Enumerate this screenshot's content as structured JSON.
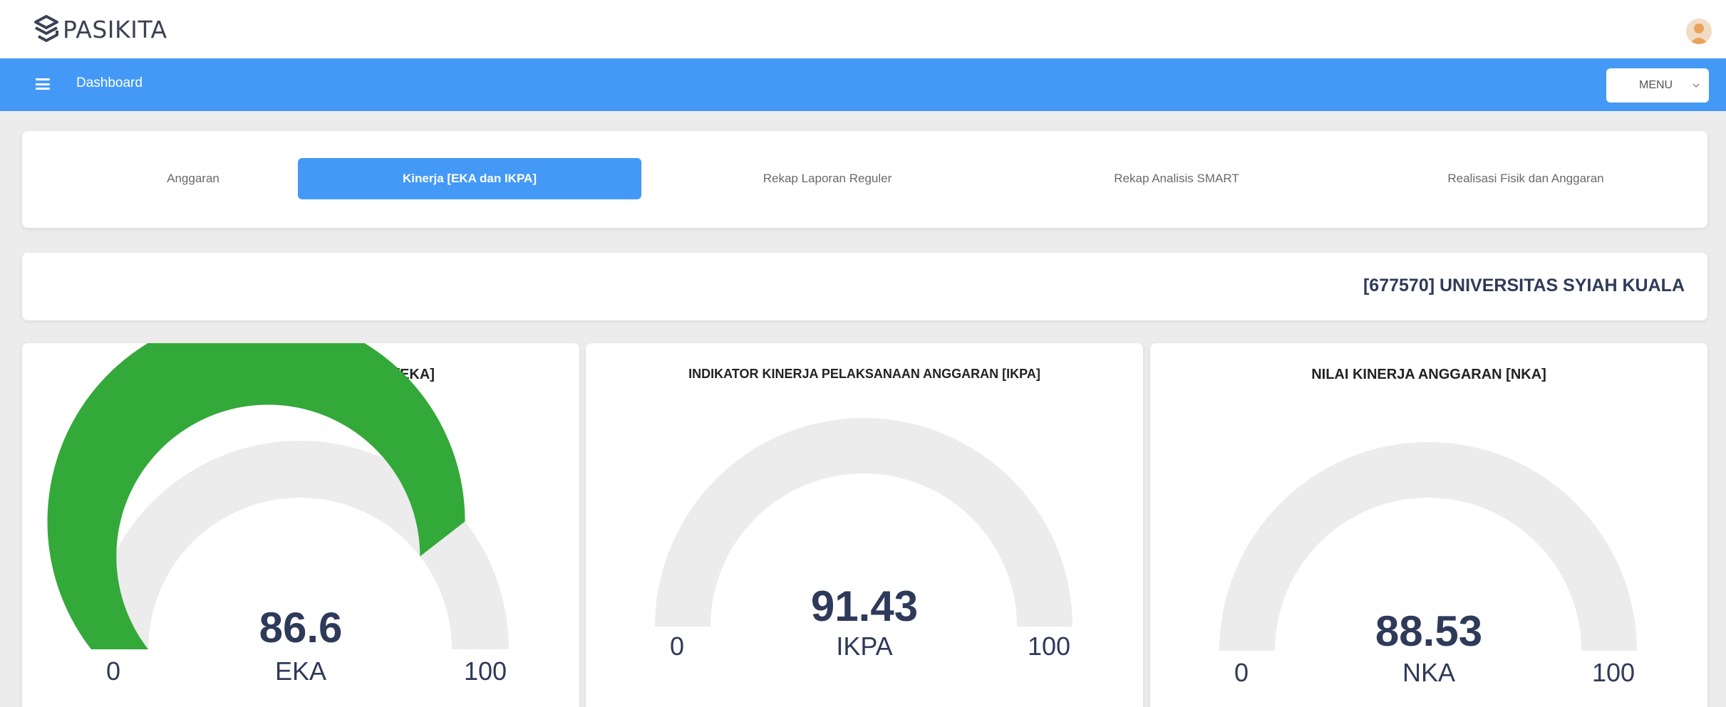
{
  "app": {
    "name": "PASIKITA"
  },
  "navbar": {
    "title": "Dashboard",
    "menu_label": "MENU"
  },
  "tabs": [
    {
      "label": "Anggaran",
      "active": false
    },
    {
      "label": "Kinerja [EKA dan IKPA]",
      "active": true
    },
    {
      "label": "Rekap Laporan Reguler",
      "active": false
    },
    {
      "label": "Rekap Analisis SMART",
      "active": false
    },
    {
      "label": "Realisasi Fisik dan Anggaran",
      "active": false
    }
  ],
  "unit": {
    "name": "[677570] UNIVERSITAS SYIAH KUALA"
  },
  "colors": {
    "primary": "#4499f6",
    "gauge_fill": "#33a93a",
    "gauge_track": "#ececec",
    "text_dark": "#2e3a59"
  },
  "gauges": [
    {
      "title": "EVALUASI KINERJA ANGGARAN [EKA]",
      "value": 86.6,
      "value_text": "86.6",
      "label": "EKA",
      "min": "0",
      "max": "100",
      "fill_fraction": 0.79
    },
    {
      "title": "INDIKATOR KINERJA PELAKSANAAN ANGGARAN [IKPA]",
      "value": 91.43,
      "value_text": "91.43",
      "label": "IKPA",
      "min": "0",
      "max": "100",
      "fill_fraction": 0
    },
    {
      "title": "NILAI KINERJA ANGGARAN [NKA]",
      "value": 88.53,
      "value_text": "88.53",
      "label": "NKA",
      "min": "0",
      "max": "100",
      "fill_fraction": 0
    }
  ]
}
